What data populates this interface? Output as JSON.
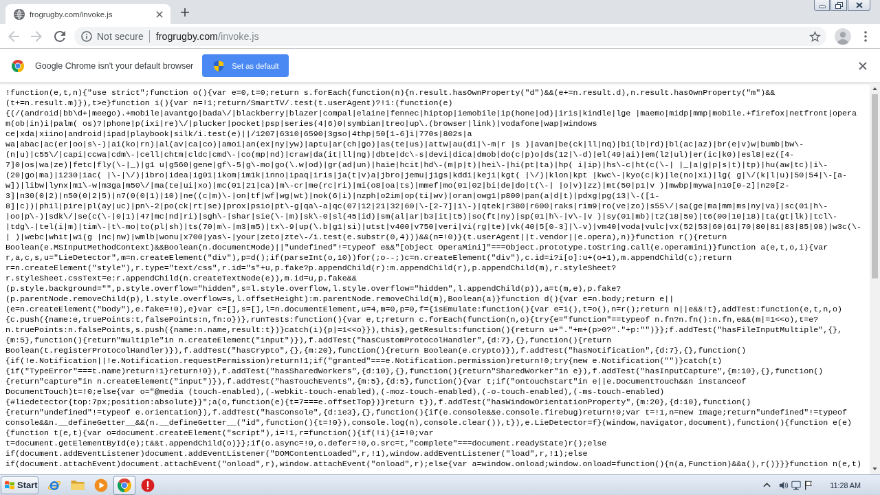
{
  "tabs": [
    {
      "title": "frogrugby.com/invoke.js",
      "selected": true
    }
  ],
  "toolbar": {
    "back": {
      "disabled": true
    },
    "forward": {
      "disabled": true
    },
    "reload": {
      "disabled": false
    }
  },
  "address_bar": {
    "security": "Not secure",
    "host": "frogrugby.com",
    "path": "/invoke.js"
  },
  "infobar": {
    "message": "Google Chrome isn't your default browser",
    "button": "Set as default"
  },
  "document": {
    "lines": [
      "!function(e,t,n){\"use strict\";function o(){var e=0,t=0;return s.forEach(function(n){n.result.hasOwnProperty(\"d\")&&(e+=n.result.d),n.result.hasOwnProperty(\"m\")&&",
      "(t+=n.result.m)}),t>e}function i(){var n=!1;return/SmartTV/.test(t.userAgent)?!1:(function(e)",
      "{(/(android|bb\\d+|meego).+mobile|avantgo|bada\\/|blackberry|blazer|compal|elaine|fennec|hiptop|iemobile|ip(hone|od)|iris|kindle|lge |maemo|midp|mmp|mobile.+firefox|netfront|opera",
      "m(ob|in)i|palm( os)?|phone|p(ixi|re)\\/|plucker|pocket|psp|series(4|6)0|symbian|treo|up\\.(browser|link)|vodafone|wap|windows",
      "ce|xda|xiino|android|ipad|playbook|silk/i.test(e)||/1207|6310|6590|3gso|4thp|50[1-6]i|770s|802s|a",
      "wa|abac|ac(er|oo|s\\-)|ai(ko|rn)|al(av|ca|co)|amoi|an(ex|ny|yw)|aptu|ar(ch|go)|as(te|us)|attw|au(di|\\-m|r |s )|avan|be(ck|ll|nq)|bi(lb|rd)|bl(ac|az)|br(e|v)w|bumb|bw\\-",
      "(n|u)|c55\\/|capi|ccwa|cdm\\-|cell|chtm|cldc|cmd\\-|co(mp|nd)|craw|da(it|ll|ng)|dbte|dc\\-s|devi|dica|dmob|do(c|p)o|ds(12|\\-d)|el(49|ai)|em(l2|ul)|er(ic|k0)|esl8|ez([4-",
      "7]0|os|wa|ze)|fetc|fly(\\-|_)|g1 u|g560|gene|gf\\-5|g\\-mo|go(\\.w|od)|gr(ad|un)|haie|hcit|hd\\-(m|p|t)|hei\\-|hi(pt|ta)|hp( i|ip)|hs\\-c|ht(c(\\-| |_|a|g|p|s|t)|tp)|hu(aw|tc)|i\\-",
      "(20|go|ma)|i230|iac( |\\-|\\/)|ibro|idea|ig01|ikom|im1k|inno|ipaq|iris|ja(t|v)a|jbro|jemu|jigs|kddi|keji|kgt( |\\/)|klon|kpt |kwc\\-|kyo(c|k)|le(no|xi)|lg( g|\\/(k|l|u)|50|54|\\-[a-",
      "w])|libw|lynx|m1\\-w|m3ga|m50\\/|ma(te|ui|xo)|mc(01|21|ca)|m\\-cr|me(rc|ri)|mi(o8|oa|ts)|mmef|mo(01|02|bi|de|do|t(\\-| |o|v)|zz)|mt(50|p1|v )|mwbp|mywa|n10[0-2]|n20[2-",
      "3]|n30(0|2)|n50(0|2|5)|n7(0(0|1)|10)|ne((c|m)\\-|on|tf|wf|wg|wt)|nok(6|i)|nzph|o2im|op(ti|wv)|oran|owg1|p800|pan(a|d|t)|pdxg|pg(13|\\-([1-",
      "8]|c))|phil|pire|pl(ay|uc)|pn\\-2|po(ck|rt|se)|prox|psio|pt\\-g|qa\\-a|qc(07|12|21|32|60|\\-[2-7]|i\\-)|qtek|r380|r600|raks|rim9|ro(ve|zo)|s55\\/|sa(ge|ma|mm|ms|ny|va)|sc(01|h\\-",
      "|oo|p\\-)|sdk\\/|se(c(\\-|0|1)|47|mc|nd|ri)|sgh\\-|shar|sie(\\-|m)|sk\\-0|sl(45|id)|sm(al|ar|b3|it|t5)|so(ft|ny)|sp(01|h\\-|v\\-|v )|sy(01|mb)|t2(18|50)|t6(00|10|18)|ta(gt|lk)|tcl\\-",
      "|tdg\\-|tel(i|m)|tim\\-|t\\-mo|to(pl|sh)|ts(70|m\\-|m3|m5)|tx\\-9|up(\\.b|g1|si)|utst|v400|v750|veri|vi(rg|te)|vk(40|5[0-3]|\\-v)|vm40|voda|vulc|vx(52|53|60|61|70|80|81|83|85|98)|w3c(\\-",
      "| )|webc|whit|wi(g |nc|nw)|wmlb|wonu|x700|yas\\-|your|zeto|zte\\-/i.test(e.substr(0,4)))&&(n=!0)}(t.userAgent||t.vendor||e.opera),n)}function r(){return",
      "Boolean(e.MSInputMethodContext)&&Boolean(n.documentMode)||\"undefined\"!=typeof e&&\"[object OperaMini]\"===Object.prototype.toString.call(e.operamini)}function a(e,t,o,i){var",
      "r,a,c,s,u=\"LieDetector\",m=n.createElement(\"div\"),p=d();if(parseInt(o,10))for(;o--;)c=n.createElement(\"div\"),c.id=i?i[o]:u+(o+1),m.appendChild(c);return",
      "r=n.createElement(\"style\"),r.type=\"text/css\",r.id=\"s\"+u,p.fake?p.appendChild(r):m.appendChild(r),p.appendChild(m),r.styleSheet?",
      "r.styleSheet.cssText=e:r.appendChild(n.createTextNode(e)),m.id=u,p.fake&&",
      "(p.style.background=\"\",p.style.overflow=\"hidden\",s=l.style.overflow,l.style.overflow=\"hidden\",l.appendChild(p)),a=t(m,e),p.fake?",
      "(p.parentNode.removeChild(p),l.style.overflow=s,l.offsetHeight):m.parentNode.removeChild(m),Boolean(a)}function d(){var e=n.body;return e||",
      "(e=n.createElement(\"body\"),e.fake=!0),e}var c=[],s=[],l=n.documentElement,u=4,m=0,p=0,f={isEmulate:function(){var e=i(),t=o(),n=r();return n||e&&!t},addTest:function(e,t,n,o)",
      "{c.push({name:e,truePoints:t,falsePoints:n,fn:o})},runTests:function(){var e,t;return c.forEach(function(n,o){try{e=\"function\"==typeof n.fn?n.fn():n.fn,e&&(m|=1<<o),t=e?",
      "n.truePoints:n.falsePoints,s.push({name:n.name,result:t})}catch(i){p|=1<<o}}),this},getResults:function(){return u+\".\"+m+(p>0?\".\"+p:\"\")}};f.addTest(\"hasFileInputMultiple\",{},",
      "{m:5},function(){return\"multiple\"in n.createElement(\"input\")}),f.addTest(\"hasCustomProtocolHandler\",{d:7},{},function(){return",
      "Boolean(t.registerProtocolHandler)}),f.addTest(\"hasCrypto\",{},{m:20},function(){return Boolean(e.crypto)}),f.addTest(\"hasNotification\",{d:7},{},function()",
      "{if(!e.Notification||!e.Notification.requestPermission)return!1;if(\"granted\"===e.Notification.permission)return!0;try{new e.Notification(\"\")}catch(t)",
      "{if(\"TypeError\"===t.name)return!1}return!0}),f.addTest(\"hasSharedWorkers\",{d:10},{},function(){return\"SharedWorker\"in e}),f.addTest(\"hasInputCapture\",{m:10},{},function()",
      "{return\"capture\"in n.createElement(\"input\")}),f.addTest(\"hasTouchEvents\",{m:5},{d:5},function(){var t;if(\"ontouchstart\"in e||e.DocumentTouch&&n instanceof",
      "DocumentTouch)t=!0;else{var o=\"@media (touch-enabled),(-webkit-touch-enabled),(-moz-touch-enabled),(-o-touch-enabled),(-ms-touch-enabled)",
      "{#liedetector{top:7px;position:absolute}}\";a(o,function(e){t=7===e.offsetTop})}return t}),f.addTest(\"hasWindowOrientationProperty\",{m:20},{d:10},function()",
      "{return\"undefined\"!=typeof e.orientation}),f.addTest(\"hasConsole\",{d:1e3},{},function(){if(e.console&&e.console.firebug)return!0;var t=!1,n=new Image;return\"undefined\"!=typeof",
      "console&&n.__defineGetter__&&(n.__defineGetter__(\"id\",function(){t=!0}),console.log(n),console.clear()),t}),e.LieDetector=f}(window,navigator,document),function(){function e(e)",
      "{function t(e,t){var o=document.createElement(\"script\"),i=!1,r=function(){if(!i){i=!0;var",
      "t=document.getElementById(e);t&&t.appendChild(o)}};if(o.async=!0,o.defer=!0,o.src=t,\"complete\"===document.readyState)r();else",
      "if(document.addEventListener)document.addEventListener(\"DOMContentLoaded\",r,!1),window.addEventListener(\"load\",r,!1);else",
      "if(document.attachEvent)document.attachEvent(\"onload\",r),window.attachEvent(\"onload\",r);else{var a=window.onload;window.onload=function(){n(a,Function)&&a(),r()}}}function n(e,t)"
    ]
  },
  "taskbar": {
    "start": "Start",
    "apps": [
      {
        "kind": "browser-e",
        "selected": false
      },
      {
        "kind": "folder",
        "selected": false
      },
      {
        "kind": "player",
        "selected": false
      },
      {
        "kind": "browser-round",
        "selected": true
      },
      {
        "kind": "alert",
        "selected": false
      }
    ],
    "clock": "11:28 AM"
  }
}
